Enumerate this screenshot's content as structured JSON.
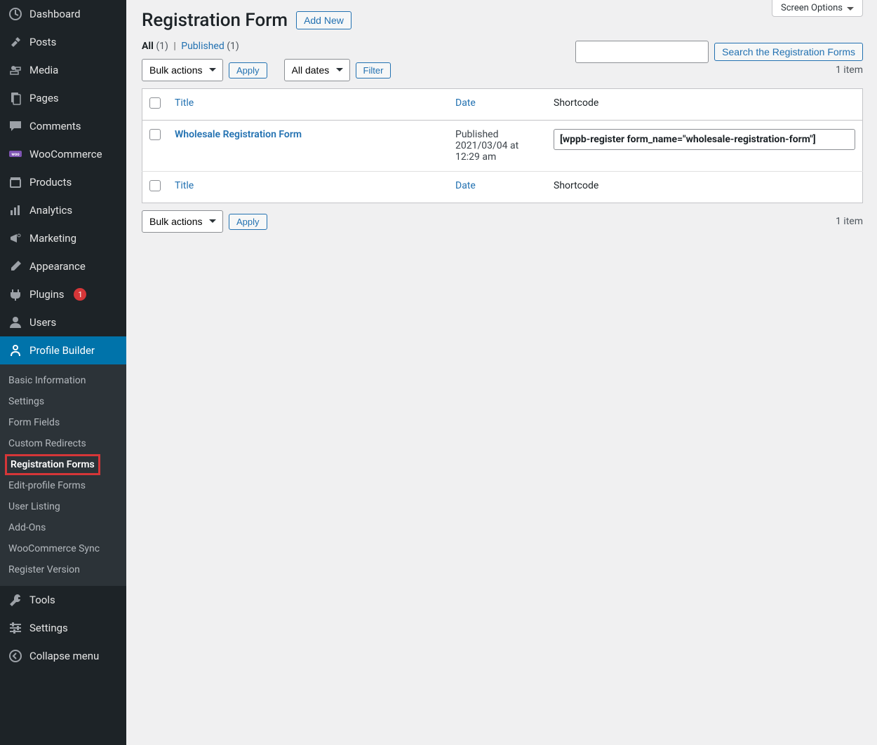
{
  "sidebar": {
    "items": [
      {
        "label": "Dashboard"
      },
      {
        "label": "Posts"
      },
      {
        "label": "Media"
      },
      {
        "label": "Pages"
      },
      {
        "label": "Comments"
      },
      {
        "label": "WooCommerce"
      },
      {
        "label": "Products"
      },
      {
        "label": "Analytics"
      },
      {
        "label": "Marketing"
      },
      {
        "label": "Appearance"
      },
      {
        "label": "Plugins",
        "badge": "1"
      },
      {
        "label": "Users"
      },
      {
        "label": "Profile Builder"
      }
    ],
    "submenu": [
      {
        "label": "Basic Information"
      },
      {
        "label": "Settings"
      },
      {
        "label": "Form Fields"
      },
      {
        "label": "Custom Redirects"
      },
      {
        "label": "Registration Forms"
      },
      {
        "label": "Edit-profile Forms"
      },
      {
        "label": "User Listing"
      },
      {
        "label": "Add-Ons"
      },
      {
        "label": "WooCommerce Sync"
      },
      {
        "label": "Register Version"
      }
    ],
    "bottom": [
      {
        "label": "Tools"
      },
      {
        "label": "Settings"
      },
      {
        "label": "Collapse menu"
      }
    ]
  },
  "screen_options_label": "Screen Options",
  "page_title": "Registration Form",
  "add_new_label": "Add New",
  "filters": {
    "all_label": "All",
    "all_count": "(1)",
    "published_label": "Published",
    "published_count": "(1)"
  },
  "search_button": "Search the Registration Forms",
  "bulk_actions_label": "Bulk actions",
  "apply_label": "Apply",
  "dates_label": "All dates",
  "filter_label": "Filter",
  "items_count": "1 item",
  "columns": {
    "title": "Title",
    "date": "Date",
    "shortcode": "Shortcode"
  },
  "row": {
    "title": "Wholesale Registration Form",
    "status": "Published",
    "date": "2021/03/04 at 12:29 am",
    "shortcode": "[wppb-register form_name=\"wholesale-registration-form\"]"
  }
}
